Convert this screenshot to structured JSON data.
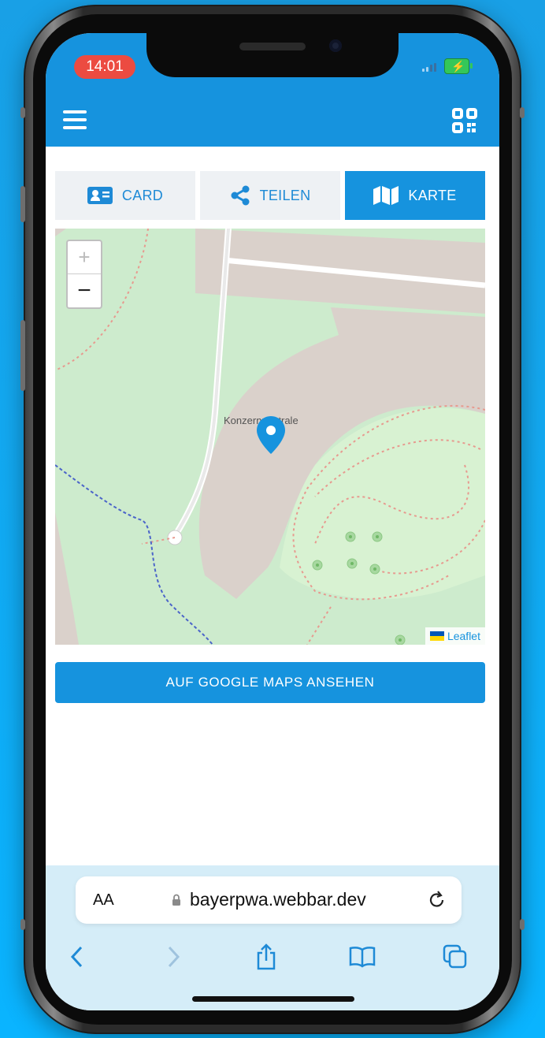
{
  "status_bar": {
    "time": "14:01"
  },
  "app": {
    "tabs": [
      {
        "label": "CARD",
        "icon": "id-card-icon",
        "active": false
      },
      {
        "label": "TEILEN",
        "icon": "share-icon",
        "active": false
      },
      {
        "label": "KARTE",
        "icon": "map-icon",
        "active": true
      }
    ]
  },
  "map": {
    "zoom_in": "+",
    "zoom_out": "−",
    "place_label": "Konzernzentrale",
    "attribution": "Leaflet"
  },
  "google_button": "AUF GOOGLE MAPS ANSEHEN",
  "browser": {
    "text_size": "AA",
    "url": "bayerpwa.webbar.dev"
  },
  "colors": {
    "brand": "#1693de",
    "page_bg": "#19a0e6",
    "map_green": "#cdebcd"
  }
}
